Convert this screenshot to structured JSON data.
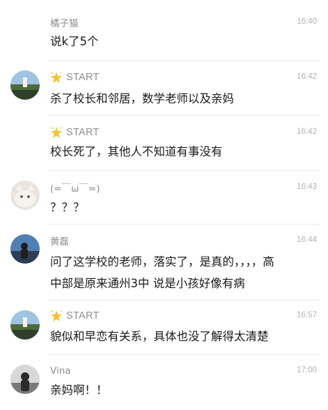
{
  "messages": [
    {
      "sender": "橘子猫",
      "time": "16:40",
      "text": "说k了5个"
    },
    {
      "sender": "START",
      "sender_icon": "sparkle-star-icon",
      "time": "16:42",
      "text": "杀了校长和邻居，数学老师以及亲妈"
    },
    {
      "sender": "START",
      "sender_icon": "sparkle-star-icon",
      "time": "16:42",
      "text": "校长死了，其他人不知道有事没有"
    },
    {
      "sender": "(=￣ω￣=)",
      "time": "16:43",
      "text": "？？？"
    },
    {
      "sender": "黄磊",
      "time": "16:44",
      "text_line1": "问了这学校的老师，落实了，是真的，，，，高",
      "text_line2": "中部是原来通州3中   说是小孩好像有病"
    },
    {
      "sender": "START",
      "sender_icon": "sparkle-star-icon",
      "time": "16:57",
      "text": "貌似和早恋有关系，具体也没了解得太清楚"
    },
    {
      "sender": "Vina",
      "time": "17:00",
      "text": "亲妈啊！！"
    }
  ],
  "colors": {
    "name": "#8e8e8e",
    "time": "#b3b3b3",
    "text": "#1a1a1a",
    "divider": "#ebebeb",
    "star": "#f2c230"
  }
}
